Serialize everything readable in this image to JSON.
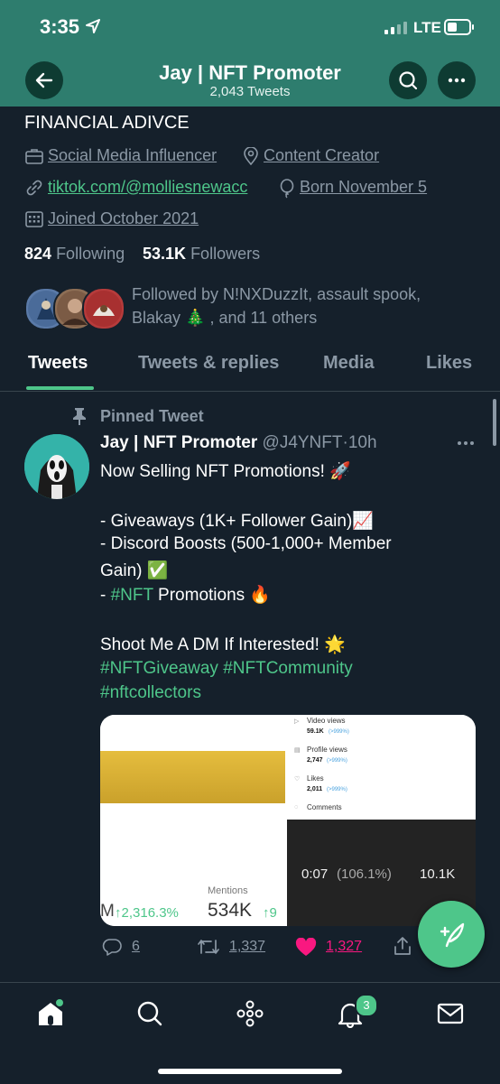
{
  "status_bar": {
    "time": "3:35",
    "network": "LTE"
  },
  "header": {
    "title": "Jay | NFT Promoter",
    "subtitle": "2,043 Tweets"
  },
  "profile": {
    "bio_line": "FINANCIAL ADIVCE",
    "category": "Social Media Influencer",
    "location": "Content Creator",
    "website": "tiktok.com/@molliesnewacc",
    "birthday": "Born November 5",
    "joined": "Joined October 2021",
    "following_count": "824",
    "following_label": "Following",
    "followers_count": "53.1K",
    "followers_label": "Followers",
    "followed_by_line1": "Followed by N!NXDuzzIt, assault spook,",
    "followed_by_line2": "Blakay 🎄 , and 11 others"
  },
  "tabs": [
    "Tweets",
    "Tweets & replies",
    "Media",
    "Likes"
  ],
  "tweet": {
    "pinned_label": "Pinned Tweet",
    "author_name": "Jay | NFT Promoter",
    "handle": "@J4YNFT",
    "dot": "·",
    "time": "10h",
    "line1": "Now Selling NFT Promotions! 🚀",
    "line2": "- Giveaways (1K+ Follower Gain)📈",
    "line3": "- Discord Boosts (500-1,000+ Member",
    "line4": "Gain) ✅",
    "line5_prefix": "- ",
    "line5_hashtag": "#NFT",
    "line5_suffix": " Promotions 🔥",
    "line6": "Shoot Me A DM If Interested! 🌟",
    "hashtags_line1": "#NFTGiveaway #NFTCommunity",
    "hashtags_line2": "#nftcollectors",
    "media": {
      "left": {
        "growth": "↑2,316.3%",
        "mentions_label": "Mentions",
        "mentions_value": "534K",
        "cut_prefix": "M",
        "cut_suffix": "↑9"
      },
      "stats": [
        {
          "label": "Video views",
          "value": "59.1K",
          "delta": "(>999%)"
        },
        {
          "label": "Profile views",
          "value": "2,747",
          "delta": "(>999%)"
        },
        {
          "label": "Likes",
          "value": "2,011",
          "delta": "(>999%)"
        },
        {
          "label": "Comments",
          "value": "",
          "delta": ""
        }
      ],
      "video_time": "0:07",
      "video_pct": "(106.1%)",
      "video_views": "10.1K"
    },
    "replies": "6",
    "retweets": "1,337",
    "likes": "1,327"
  },
  "nav": {
    "notifications_badge": "3"
  },
  "colors": {
    "header_bg": "#2e7d6e",
    "background": "#15202b",
    "accent_green": "#4ec68a",
    "like_pink": "#f91880"
  }
}
